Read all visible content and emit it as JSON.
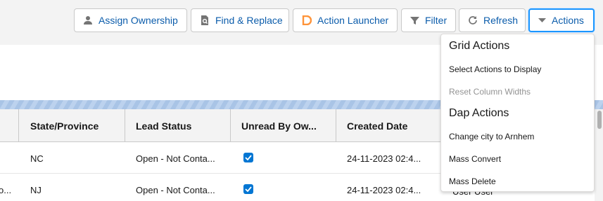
{
  "toolbar": {
    "assign_ownership": "Assign Ownership",
    "find_replace": "Find & Replace",
    "action_launcher": "Action Launcher",
    "filter": "Filter",
    "refresh": "Refresh",
    "actions": "Actions"
  },
  "grid": {
    "columns": [
      "State/Province",
      "Lead Status",
      "Unread By Ow...",
      "Created Date"
    ],
    "rows": [
      {
        "lead_cut": "",
        "state": "NC",
        "status": "Open - Not Conta...",
        "unread": true,
        "created": "24-11-2023 02:4...",
        "owner": ""
      },
      {
        "lead_cut": "o...",
        "state": "NJ",
        "status": "Open - Not Conta...",
        "unread": true,
        "created": "24-11-2023 02:4...",
        "owner": "User User"
      }
    ]
  },
  "actions_menu": {
    "grid_actions_heading": "Grid Actions",
    "select_actions": "Select Actions to Display",
    "reset_widths": "Reset Column Widths",
    "dap_actions_heading": "Dap Actions",
    "change_city": "Change city to Arnhem",
    "mass_convert": "Mass Convert",
    "mass_delete": "Mass Delete"
  },
  "colors": {
    "accent": "#0176d3",
    "link": "#0b5cab",
    "launcher_orange": "#fe9339"
  },
  "icons": [
    "user-icon",
    "find-replace-icon",
    "action-launcher-icon",
    "filter-icon",
    "refresh-icon",
    "caret-down-icon",
    "checkbox-checked-icon"
  ]
}
